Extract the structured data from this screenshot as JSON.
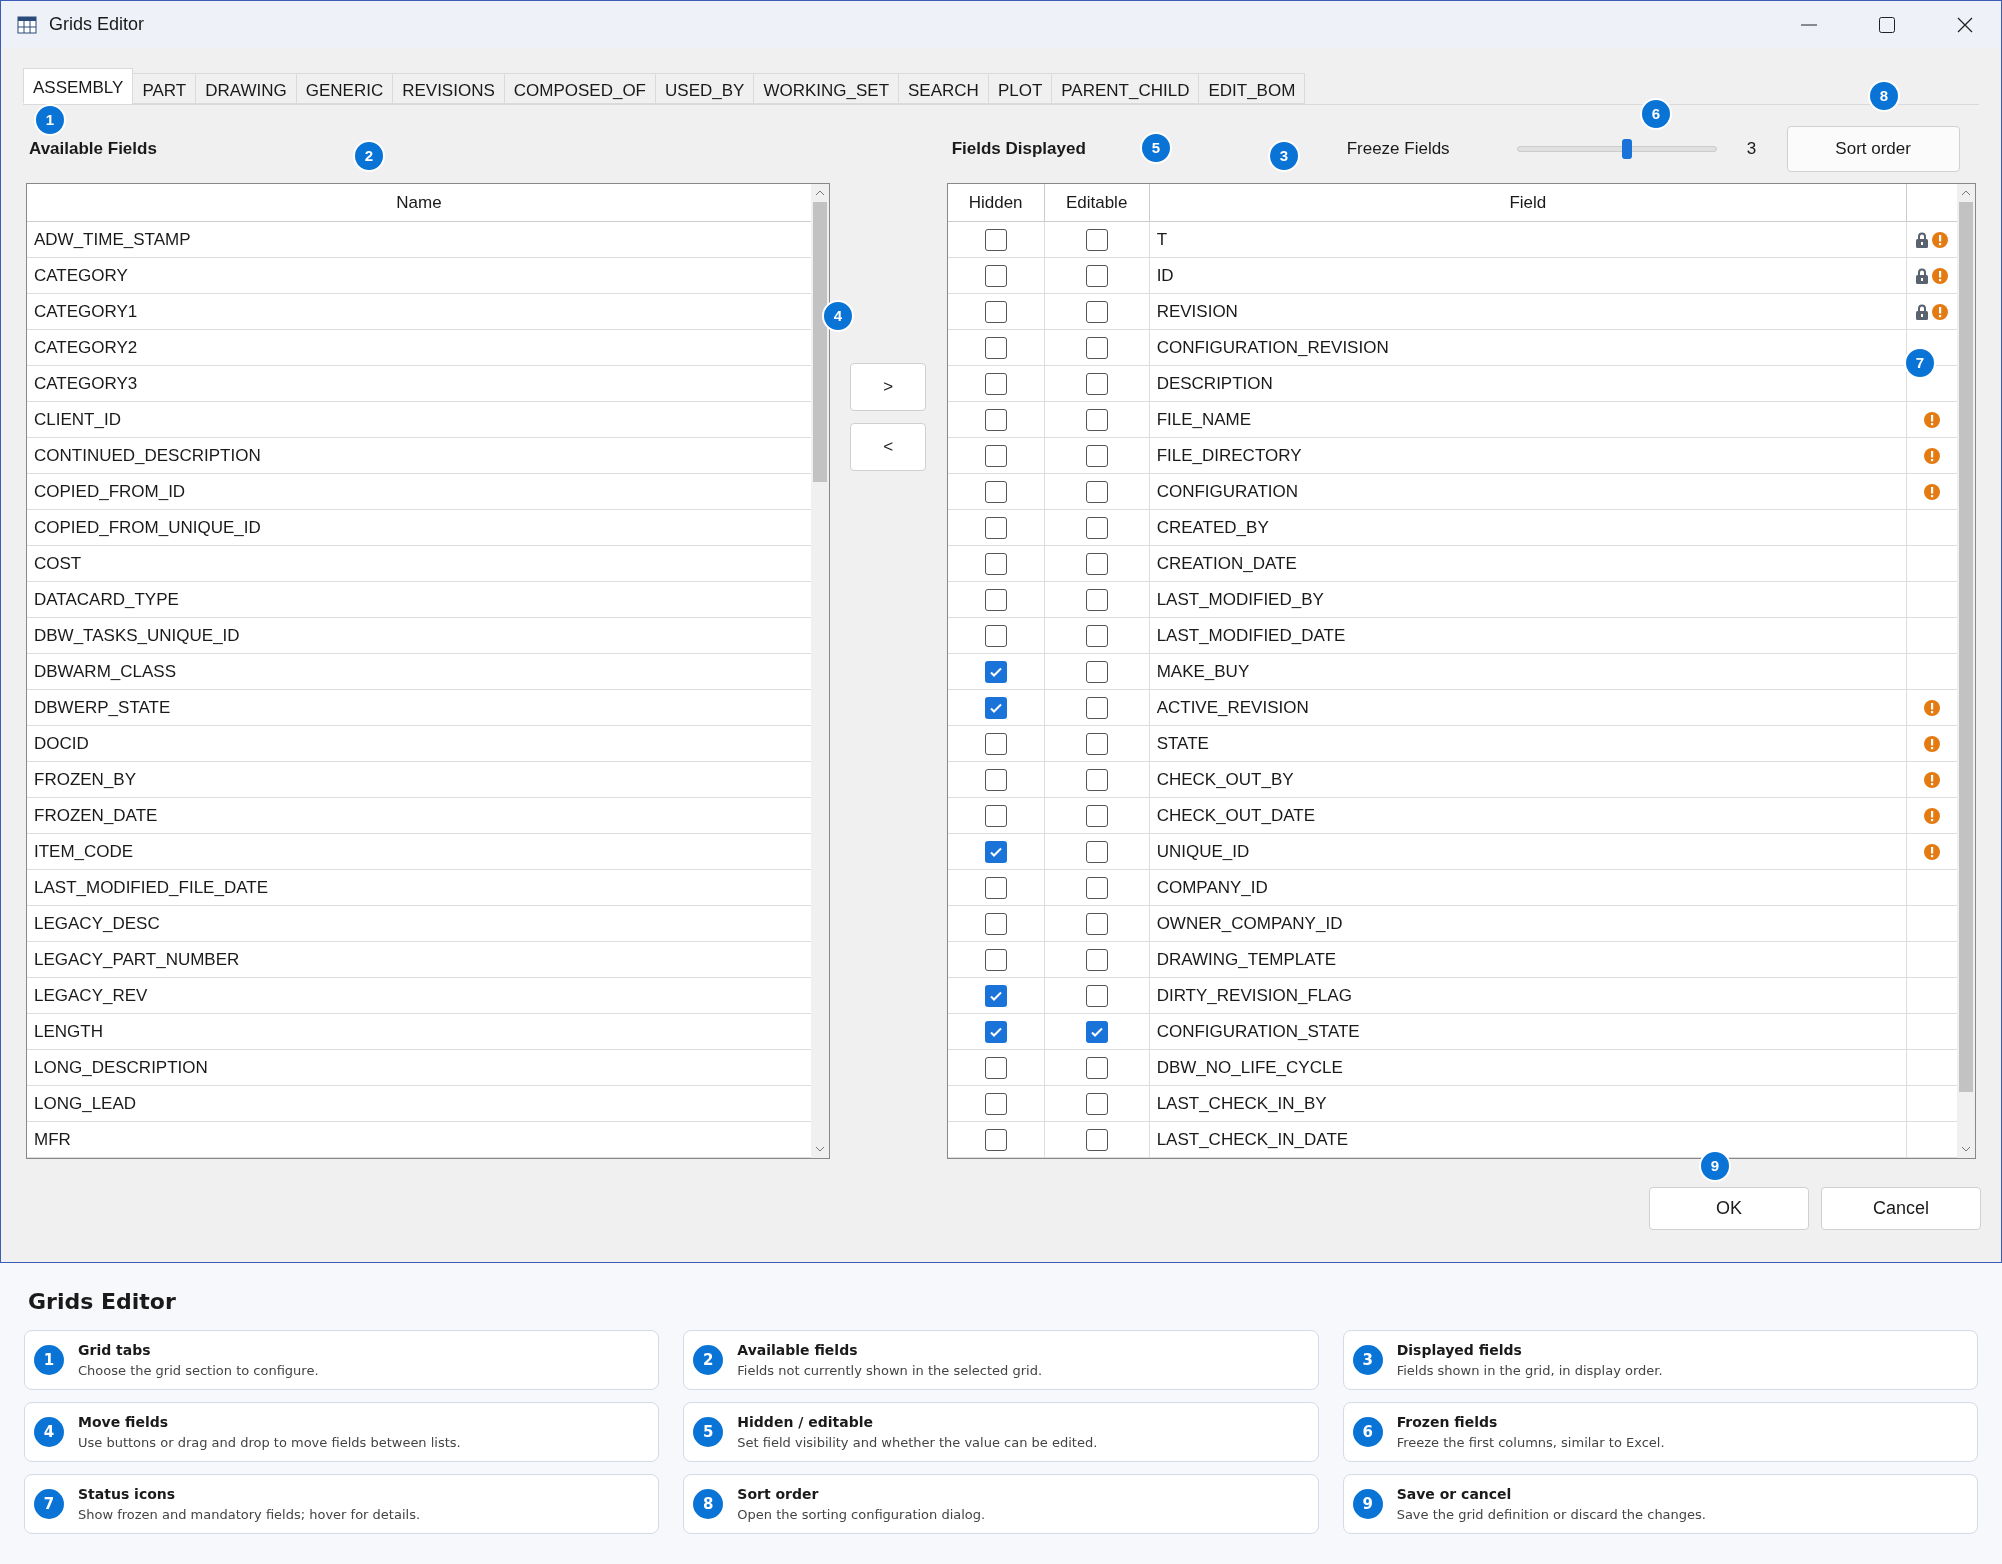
{
  "window": {
    "title": "Grids Editor"
  },
  "tabs": [
    {
      "label": "ASSEMBLY",
      "selected": true
    },
    {
      "label": "PART",
      "selected": false
    },
    {
      "label": "DRAWING",
      "selected": false
    },
    {
      "label": "GENERIC",
      "selected": false
    },
    {
      "label": "REVISIONS",
      "selected": false
    },
    {
      "label": "COMPOSED_OF",
      "selected": false
    },
    {
      "label": "USED_BY",
      "selected": false
    },
    {
      "label": "WORKING_SET",
      "selected": false
    },
    {
      "label": "SEARCH",
      "selected": false
    },
    {
      "label": "PLOT",
      "selected": false
    },
    {
      "label": "PARENT_CHILD",
      "selected": false
    },
    {
      "label": "EDIT_BOM",
      "selected": false
    }
  ],
  "available": {
    "title": "Available Fields",
    "column": "Name",
    "items": [
      "ADW_TIME_STAMP",
      "CATEGORY",
      "CATEGORY1",
      "CATEGORY2",
      "CATEGORY3",
      "CLIENT_ID",
      "CONTINUED_DESCRIPTION",
      "COPIED_FROM_ID",
      "COPIED_FROM_UNIQUE_ID",
      "COST",
      "DATACARD_TYPE",
      "DBW_TASKS_UNIQUE_ID",
      "DBWARM_CLASS",
      "DBWERP_STATE",
      "DOCID",
      "FROZEN_BY",
      "FROZEN_DATE",
      "ITEM_CODE",
      "LAST_MODIFIED_FILE_DATE",
      "LEGACY_DESC",
      "LEGACY_PART_NUMBER",
      "LEGACY_REV",
      "LENGTH",
      "LONG_DESCRIPTION",
      "LONG_LEAD",
      "MFR"
    ]
  },
  "move_buttons": [
    ">",
    "<"
  ],
  "displayed": {
    "title": "Fields Displayed",
    "freeze_label": "Freeze Fields",
    "freeze": {
      "level": 0.55
    },
    "freeze_value": "3",
    "sort_button": "Sort order",
    "columns": [
      "Hidden",
      "Editable",
      "Field"
    ],
    "rows": [
      {
        "field": "T",
        "hidden": false,
        "editable": false,
        "locked": true,
        "mandatory": true
      },
      {
        "field": "ID",
        "hidden": false,
        "editable": false,
        "locked": true,
        "mandatory": true
      },
      {
        "field": "REVISION",
        "hidden": false,
        "editable": false,
        "locked": true,
        "mandatory": true
      },
      {
        "field": "CONFIGURATION_REVISION",
        "hidden": false,
        "editable": false,
        "locked": false,
        "mandatory": false
      },
      {
        "field": "DESCRIPTION",
        "hidden": false,
        "editable": false,
        "locked": false,
        "mandatory": false
      },
      {
        "field": "FILE_NAME",
        "hidden": false,
        "editable": false,
        "locked": false,
        "mandatory": true
      },
      {
        "field": "FILE_DIRECTORY",
        "hidden": false,
        "editable": false,
        "locked": false,
        "mandatory": true
      },
      {
        "field": "CONFIGURATION",
        "hidden": false,
        "editable": false,
        "locked": false,
        "mandatory": true
      },
      {
        "field": "CREATED_BY",
        "hidden": false,
        "editable": false,
        "locked": false,
        "mandatory": false
      },
      {
        "field": "CREATION_DATE",
        "hidden": false,
        "editable": false,
        "locked": false,
        "mandatory": false
      },
      {
        "field": "LAST_MODIFIED_BY",
        "hidden": false,
        "editable": false,
        "locked": false,
        "mandatory": false
      },
      {
        "field": "LAST_MODIFIED_DATE",
        "hidden": false,
        "editable": false,
        "locked": false,
        "mandatory": false
      },
      {
        "field": "MAKE_BUY",
        "hidden": true,
        "editable": false,
        "locked": false,
        "mandatory": false
      },
      {
        "field": "ACTIVE_REVISION",
        "hidden": true,
        "editable": false,
        "locked": false,
        "mandatory": true
      },
      {
        "field": "STATE",
        "hidden": false,
        "editable": false,
        "locked": false,
        "mandatory": true
      },
      {
        "field": "CHECK_OUT_BY",
        "hidden": false,
        "editable": false,
        "locked": false,
        "mandatory": true
      },
      {
        "field": "CHECK_OUT_DATE",
        "hidden": false,
        "editable": false,
        "locked": false,
        "mandatory": true
      },
      {
        "field": "UNIQUE_ID",
        "hidden": true,
        "editable": false,
        "locked": false,
        "mandatory": true
      },
      {
        "field": "COMPANY_ID",
        "hidden": false,
        "editable": false,
        "locked": false,
        "mandatory": false
      },
      {
        "field": "OWNER_COMPANY_ID",
        "hidden": false,
        "editable": false,
        "locked": false,
        "mandatory": false
      },
      {
        "field": "DRAWING_TEMPLATE",
        "hidden": false,
        "editable": false,
        "locked": false,
        "mandatory": false
      },
      {
        "field": "DIRTY_REVISION_FLAG",
        "hidden": true,
        "editable": false,
        "locked": false,
        "mandatory": false
      },
      {
        "field": "CONFIGURATION_STATE",
        "hidden": true,
        "editable": true,
        "locked": false,
        "mandatory": false
      },
      {
        "field": "DBW_NO_LIFE_CYCLE",
        "hidden": false,
        "editable": false,
        "locked": false,
        "mandatory": false
      },
      {
        "field": "LAST_CHECK_IN_BY",
        "hidden": false,
        "editable": false,
        "locked": false,
        "mandatory": false
      },
      {
        "field": "LAST_CHECK_IN_DATE",
        "hidden": false,
        "editable": false,
        "locked": false,
        "mandatory": false
      }
    ]
  },
  "dialog_buttons": [
    "OK",
    "Cancel"
  ],
  "callouts": [
    "1",
    "2",
    "3",
    "4",
    "5",
    "6",
    "7",
    "8",
    "9"
  ],
  "legend": {
    "title": "Grids Editor",
    "items": [
      {
        "number": "1",
        "title": "Grid tabs",
        "text": "Choose the grid section to configure."
      },
      {
        "number": "2",
        "title": "Available fields",
        "text": "Fields not currently shown in the selected grid."
      },
      {
        "number": "3",
        "title": "Displayed fields",
        "text": "Fields shown in the grid, in display order."
      },
      {
        "number": "4",
        "title": "Move fields",
        "text": "Use buttons or drag and drop to move fields between lists."
      },
      {
        "number": "5",
        "title": "Hidden / editable",
        "text": "Set field visibility and whether the value can be edited."
      },
      {
        "number": "6",
        "title": "Frozen fields",
        "text": "Freeze the first columns, similar to Excel."
      },
      {
        "number": "7",
        "title": "Status icons",
        "text": "Show frozen and mandatory fields; hover for details."
      },
      {
        "number": "8",
        "title": "Sort order",
        "text": "Open the sorting configuration dialog."
      },
      {
        "number": "9",
        "title": "Save or cancel",
        "text": "Save the grid definition or discard the changes."
      }
    ]
  }
}
